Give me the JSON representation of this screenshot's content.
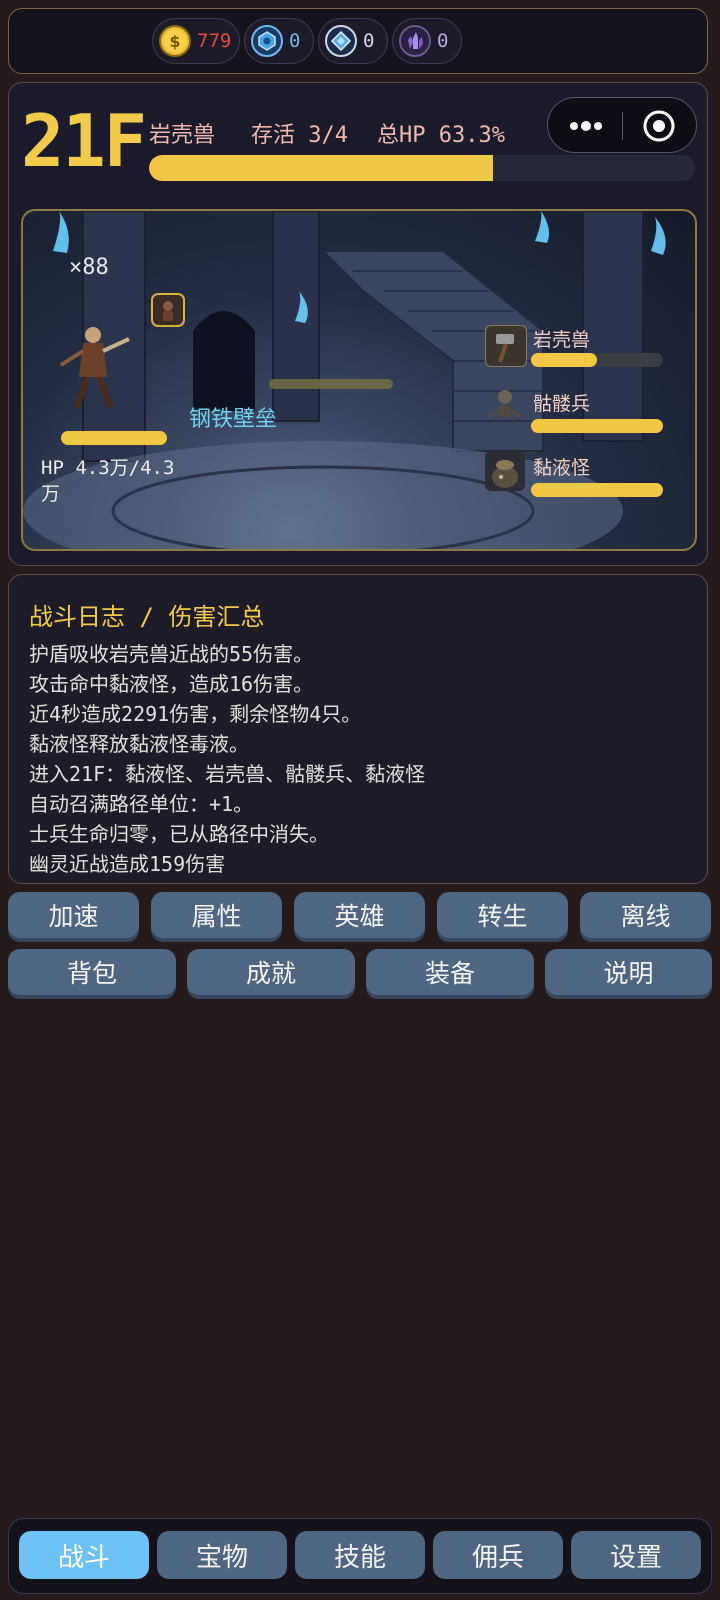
{
  "currencies": [
    {
      "icon": "gold-coin-icon",
      "value": "779",
      "color": "#e8483c"
    },
    {
      "icon": "blue-gem-icon",
      "value": "0",
      "color": "#6fb8f0"
    },
    {
      "icon": "diamond-gem-icon",
      "value": "0",
      "color": "#d0d8ea"
    },
    {
      "icon": "purple-crystal-icon",
      "value": "0",
      "color": "#b9a6e6"
    }
  ],
  "floor": {
    "label": "21F",
    "monster": "岩壳兽",
    "survive": "存活 3/4",
    "total_hp": "总HP 63.3%",
    "total_hp_fraction": 0.63
  },
  "scene": {
    "wave_count": "×88",
    "skill_text": "钢铁壁垒",
    "hero_hp_label": "HP 4.3万/4.3万",
    "hero_hp_fraction": 1.0,
    "enemies": [
      {
        "name": "岩壳兽",
        "icon": "hammer-icon",
        "hp_fraction": 0.5
      },
      {
        "name": "骷髅兵",
        "icon": "skeleton-icon",
        "hp_fraction": 1.0
      },
      {
        "name": "黏液怪",
        "icon": "slime-pot-icon",
        "hp_fraction": 1.0
      }
    ]
  },
  "log": {
    "title": "战斗日志 / 伤害汇总",
    "lines": [
      "护盾吸收岩壳兽近战的55伤害。",
      "攻击命中黏液怪，造成16伤害。",
      "近4秒造成2291伤害，剩余怪物4只。",
      "黏液怪释放黏液怪毒液。",
      "进入21F：黏液怪、岩壳兽、骷髅兵、黏液怪",
      "自动召满路径单位：+1。",
      "士兵生命归零，已从路径中消失。",
      "幽灵近战造成159伤害"
    ]
  },
  "actions_row1": [
    "加速",
    "属性",
    "英雄",
    "转生",
    "离线"
  ],
  "actions_row2": [
    "背包",
    "成就",
    "装备",
    "说明"
  ],
  "nav": [
    {
      "label": "战斗",
      "active": true
    },
    {
      "label": "宝物",
      "active": false
    },
    {
      "label": "技能",
      "active": false
    },
    {
      "label": "佣兵",
      "active": false
    },
    {
      "label": "设置",
      "active": false
    }
  ]
}
